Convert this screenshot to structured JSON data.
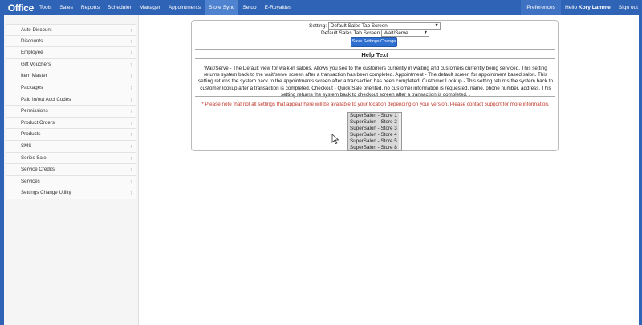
{
  "app": {
    "logo_mark": "!",
    "logo_text": "Office"
  },
  "topnav": {
    "items": [
      {
        "label": "Tools"
      },
      {
        "label": "Sales"
      },
      {
        "label": "Reports"
      },
      {
        "label": "Scheduler"
      },
      {
        "label": "Manager"
      },
      {
        "label": "Appointments"
      },
      {
        "label": "Store Sync"
      },
      {
        "label": "Setup"
      },
      {
        "label": "E-Royalties"
      }
    ],
    "active_item": "Store Sync",
    "preferences": "Preferences",
    "hello_prefix": "Hello",
    "user_name": "Kory Lamme",
    "sign_out": "Sign out"
  },
  "sidebar": {
    "items": [
      {
        "label": "Auto Discount"
      },
      {
        "label": "Discounts"
      },
      {
        "label": "Employee"
      },
      {
        "label": "Gift Vouchers"
      },
      {
        "label": "Item Master"
      },
      {
        "label": "Packages"
      },
      {
        "label": "Paid in/out Acct Codes"
      },
      {
        "label": "Permissions"
      },
      {
        "label": "Product Orders"
      },
      {
        "label": "Products"
      },
      {
        "label": "SMS"
      },
      {
        "label": "Series Sale"
      },
      {
        "label": "Service Credits"
      },
      {
        "label": "Services"
      },
      {
        "label": "Settings Change Utility"
      }
    ]
  },
  "settings": {
    "setting_label": "Setting:",
    "setting_value": "Default Sales Tab Screen",
    "field_label": "Default Sales Tab Screen",
    "field_value": "Wait/Serve",
    "save_button": "Save Settings Change",
    "help_title": "Help Text",
    "help_text": "Wait/Serve - The Default view for walk-in salons. Allows you see to the customers currently in waiting and customers currently being serviced. This setting returns system back to the wait/serve screen after a transaction has been completed. Appointment - The default screen for appointment based salon. This setting returns the system back to the appointments screen after a transaction has been completed. Customer Lookup - This setting returns the system back to customer lookup after a transaction is completed. Checkout - Quick Sale oriented, no customer information is requested, name, phone number, address. This setting returns the system back to checkout screen after a transaction is completed. .",
    "notice": "* Please note that not all settings that appear here will be available to your location depending on your version. Please contact support for more information.",
    "stores": [
      {
        "label": "SuperSalon - Store 1"
      },
      {
        "label": "SuperSalon - Store 2"
      },
      {
        "label": "SuperSalon - Store 3"
      },
      {
        "label": "SuperSalon - Store 4"
      },
      {
        "label": "SuperSalon - Store 5"
      },
      {
        "label": "SuperSalon - Store 8"
      }
    ]
  },
  "colors": {
    "nav_bg": "#2f63b6",
    "nav_active": "#4f83cf",
    "button_bg": "#2f6fd0",
    "notice": "#c0392b"
  }
}
